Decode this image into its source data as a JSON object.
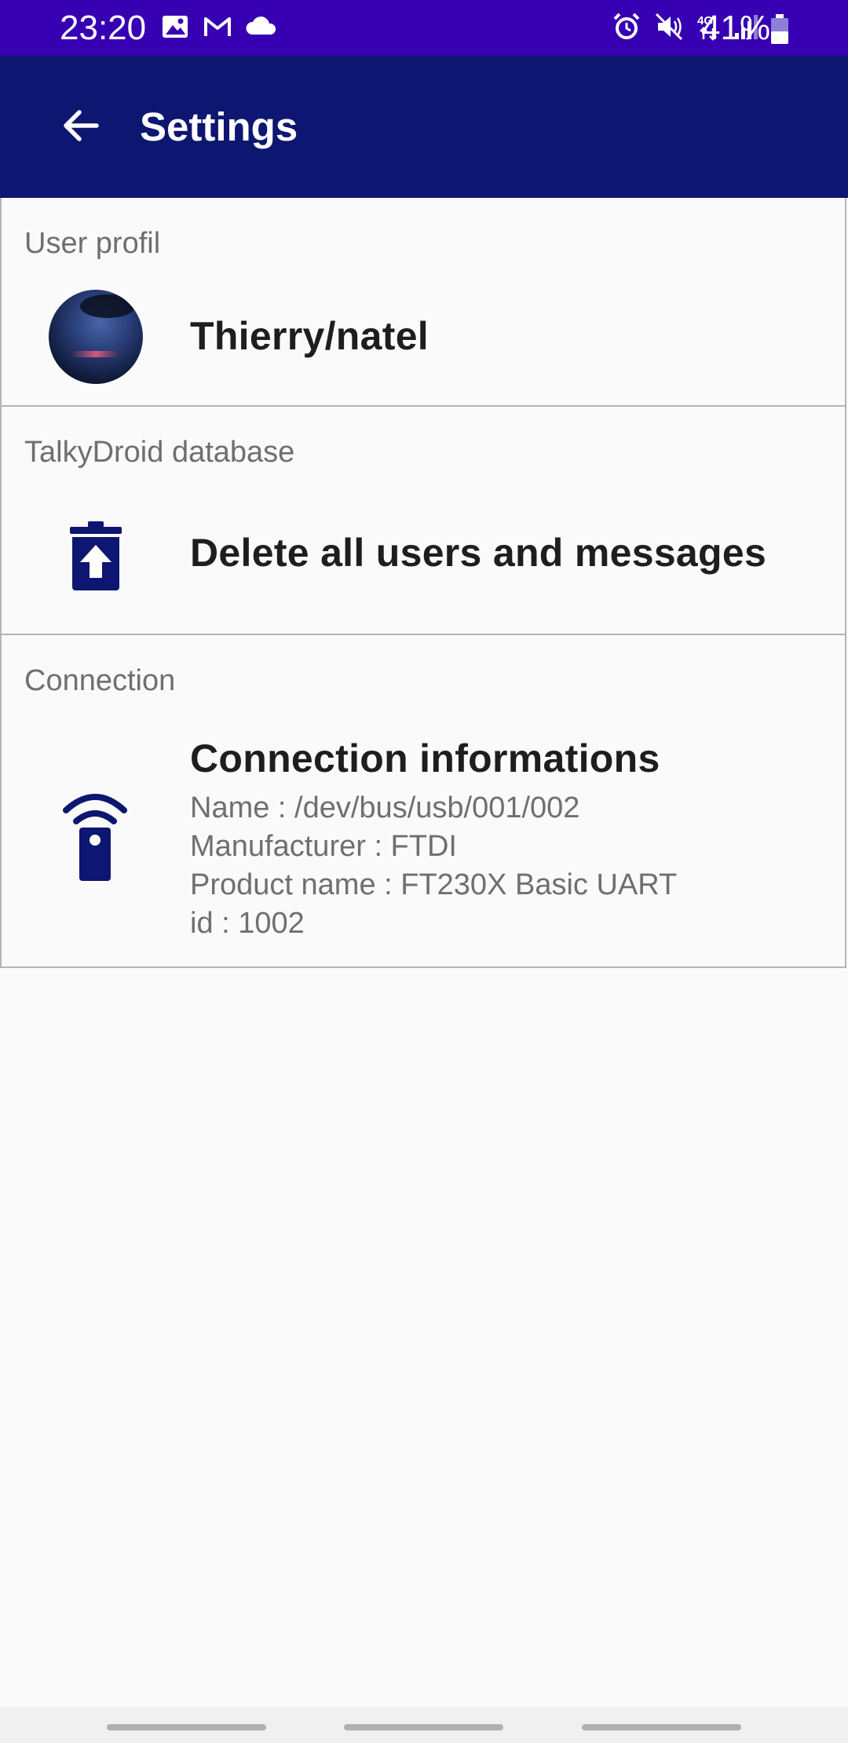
{
  "status_bar": {
    "time": "23:20",
    "battery_text": "41%",
    "left_icons": [
      "gallery-icon",
      "gmail-icon",
      "cloud-icon"
    ],
    "right_icons": [
      "alarm-icon",
      "mute-icon",
      "4g-icon",
      "signal-icon",
      "battery-icon"
    ]
  },
  "app_bar": {
    "title": "Settings",
    "back_icon": "back-arrow-icon"
  },
  "sections": {
    "user_profile": {
      "label": "User profil",
      "name": "Thierry/natel"
    },
    "database": {
      "label": "TalkyDroid database",
      "action": "Delete all users and messages",
      "icon": "delete-icon"
    },
    "connection": {
      "label": "Connection",
      "title": "Connection informations",
      "icon": "remote-icon",
      "details": [
        "Name : /dev/bus/usb/001/002",
        "Manufacturer : FTDI",
        "Product name : FT230X Basic UART",
        "id : 1002"
      ]
    }
  },
  "colors": {
    "status_bar": "#3700b3",
    "app_bar": "#0d1670",
    "icon": "#0d1670",
    "background": "#fafafa"
  }
}
